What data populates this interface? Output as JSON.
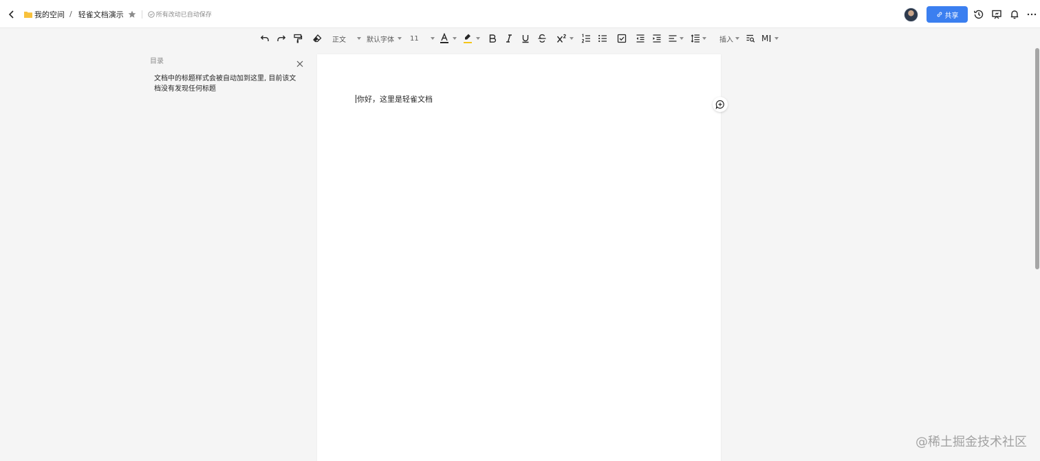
{
  "header": {
    "breadcrumb": {
      "space": "我的空间",
      "separator": "/",
      "doc_title": "轻雀文档演示"
    },
    "save_status": "所有改动已自动保存",
    "share_label": "共享",
    "icons": [
      "back-icon",
      "folder-icon",
      "star-icon",
      "check-circle-icon",
      "link-icon",
      "history-icon",
      "presentation-icon",
      "bell-icon",
      "more-icon"
    ]
  },
  "toolbar": {
    "style_select": "正文",
    "font_select": "默认字体",
    "size_select": "11",
    "insert_label": "插入",
    "markdown_label": "M",
    "font_color": "#262626",
    "highlight_color": "#f5c518",
    "icons": [
      "undo-icon",
      "redo-icon",
      "format-painter-icon",
      "eraser-icon",
      "font-color-icon",
      "highlight-icon",
      "bold-icon",
      "italic-icon",
      "underline-icon",
      "strikethrough-icon",
      "superscript-icon",
      "ordered-list-icon",
      "bullet-list-icon",
      "checklist-icon",
      "outdent-icon",
      "indent-icon",
      "align-icon",
      "line-height-icon",
      "find-icon",
      "markdown-icon"
    ]
  },
  "outline": {
    "title": "目录",
    "empty_text": "文档中的标题样式会被自动加到这里, 目前该文档没有发现任何标题"
  },
  "document": {
    "paragraph": "你好，这里是轻雀文档"
  },
  "watermark": "@稀土掘金技术社区",
  "colors": {
    "accent": "#3b7ff0",
    "background": "#f5f5f5",
    "page": "#ffffff"
  }
}
